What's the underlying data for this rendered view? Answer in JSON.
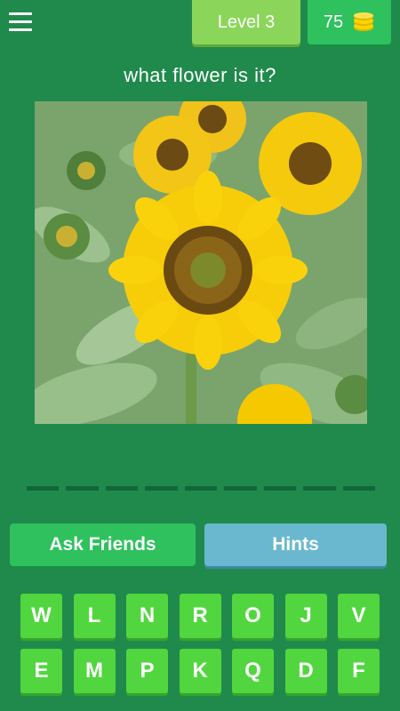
{
  "header": {
    "level_label": "Level 3",
    "coins": "75",
    "menu_icon": "hamburger-menu-icon",
    "coin_icon": "coin-stack-icon"
  },
  "question": "what flower is it?",
  "image": {
    "subject_icon": "sunflower-photo"
  },
  "answer": {
    "slot_count": 9
  },
  "buttons": {
    "ask_friends": "Ask Friends",
    "hints": "Hints"
  },
  "keyboard": {
    "row1": [
      "W",
      "L",
      "N",
      "R",
      "O",
      "J",
      "V"
    ],
    "row2": [
      "E",
      "M",
      "P",
      "K",
      "Q",
      "D",
      "F"
    ]
  },
  "colors": {
    "background": "#1f8a4c",
    "level_pill": "#8bd65a",
    "coins_pill": "#2ec15e",
    "ask_button": "#2ec15e",
    "hints_button": "#6ab8cf",
    "key": "#52d63f"
  }
}
